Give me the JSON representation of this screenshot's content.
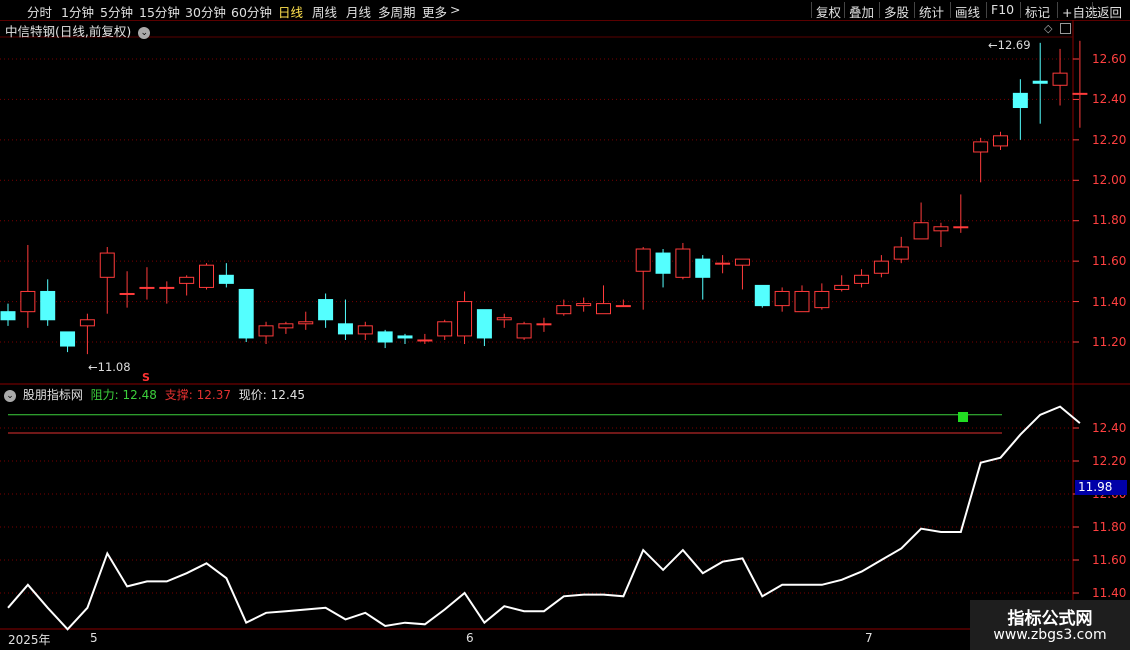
{
  "toolbar": {
    "periods": [
      "分时",
      "1分钟",
      "5分钟",
      "15分钟",
      "30分钟",
      "60分钟",
      "日线",
      "周线",
      "月线",
      "多周期",
      "更多"
    ],
    "active": "日线",
    "more_arrow": ">",
    "actions": [
      "复权",
      "叠加",
      "多股",
      "统计",
      "画线",
      "F10",
      "标记",
      "+自选",
      "返回"
    ]
  },
  "main_panel": {
    "title": "中信特钢(日线,前复权)",
    "dropdown_icon": "chevron-down-icon",
    "diamond_icon": "diamond-icon",
    "square_icon": "panel-toggle-icon",
    "price_labels": [
      "12.60",
      "12.40",
      "12.20",
      "12.00",
      "11.80",
      "11.60",
      "11.40",
      "11.20"
    ],
    "high_marker": "12.69",
    "low_marker": "11.08",
    "s_marker": "S"
  },
  "indicator_panel": {
    "name": "股朋指标网",
    "resistance_label": "阻力:",
    "resistance_value": "12.48",
    "support_label": "支撑:",
    "support_value": "12.37",
    "price_label": "现价:",
    "price_value": "12.45",
    "price_labels": [
      "12.40",
      "12.20",
      "12.00",
      "11.80",
      "11.60",
      "11.40"
    ],
    "current_tag": "11.98",
    "dropdown_icon": "chevron-down-icon"
  },
  "date_axis": {
    "year": "2025年",
    "months": [
      "5",
      "6",
      "7"
    ]
  },
  "watermark": {
    "title": "指标公式网",
    "url": "www.zbgs3.com"
  },
  "colors": {
    "up": "#ff3b3b",
    "down": "#54ffff",
    "grid": "#7a0000",
    "resistance": "#3ccf3c",
    "support": "#e03030",
    "line": "#ffffff",
    "active_period": "#ffe14d",
    "current_tag_bg": "#0000a8"
  },
  "chart_data": {
    "type": "candlestick",
    "x": [
      0,
      1,
      2,
      3,
      4,
      5,
      6,
      7,
      8,
      9,
      10,
      11,
      12,
      13,
      14,
      15,
      16,
      17,
      18,
      19,
      20,
      21,
      22,
      23,
      24,
      25,
      26,
      27,
      28,
      29,
      30,
      31,
      32,
      33,
      34,
      35,
      36,
      37,
      38,
      39,
      40,
      41,
      42,
      43,
      44,
      45,
      46,
      47,
      48,
      49,
      50
    ],
    "open": [
      11.35,
      11.35,
      11.45,
      11.25,
      11.28,
      11.52,
      11.44,
      11.47,
      11.47,
      11.49,
      11.47,
      11.53,
      11.46,
      11.23,
      11.27,
      11.29,
      11.41,
      11.29,
      11.24,
      11.25,
      11.23,
      11.21,
      11.23,
      11.23,
      11.36,
      11.31,
      11.22,
      11.29,
      11.34,
      11.38,
      11.34,
      11.38,
      11.55,
      11.64,
      11.52,
      11.61,
      11.59,
      11.58,
      11.48,
      11.38,
      11.35,
      11.37,
      11.46,
      11.49,
      11.54,
      11.61,
      11.71,
      11.75,
      11.77,
      12.14,
      12.17,
      12.43,
      12.49,
      12.47,
      12.43
    ],
    "close": [
      11.31,
      11.45,
      11.31,
      11.18,
      11.31,
      11.64,
      11.44,
      11.47,
      11.47,
      11.52,
      11.58,
      11.49,
      11.22,
      11.28,
      11.29,
      11.3,
      11.31,
      11.24,
      11.28,
      11.2,
      11.22,
      11.21,
      11.3,
      11.4,
      11.22,
      11.32,
      11.29,
      11.29,
      11.38,
      11.39,
      11.39,
      11.38,
      11.66,
      11.54,
      11.66,
      11.52,
      11.59,
      11.61,
      11.38,
      11.45,
      11.45,
      11.45,
      11.48,
      11.53,
      11.6,
      11.67,
      11.79,
      11.77,
      11.77,
      12.19,
      12.22,
      12.36,
      12.48,
      12.53,
      12.43
    ],
    "high": [
      11.39,
      11.68,
      11.51,
      11.21,
      11.34,
      11.67,
      11.55,
      11.57,
      11.5,
      11.53,
      11.59,
      11.59,
      11.46,
      11.3,
      11.3,
      11.35,
      11.44,
      11.41,
      11.3,
      11.26,
      11.24,
      11.24,
      11.31,
      11.45,
      11.36,
      11.34,
      11.3,
      11.32,
      11.41,
      11.42,
      11.48,
      11.41,
      11.67,
      11.66,
      11.69,
      11.63,
      11.63,
      11.61,
      11.48,
      11.47,
      11.48,
      11.49,
      11.53,
      11.56,
      11.63,
      11.72,
      11.89,
      11.79,
      11.93,
      12.21,
      12.24,
      12.5,
      12.68,
      12.65,
      12.69
    ],
    "low": [
      11.28,
      11.27,
      11.28,
      11.15,
      11.14,
      11.34,
      11.37,
      11.41,
      11.39,
      11.43,
      11.46,
      11.47,
      11.2,
      11.19,
      11.24,
      11.26,
      11.27,
      11.21,
      11.21,
      11.17,
      11.19,
      11.19,
      11.21,
      11.19,
      11.18,
      11.27,
      11.21,
      11.25,
      11.33,
      11.35,
      11.35,
      11.38,
      11.36,
      11.47,
      11.51,
      11.41,
      11.54,
      11.46,
      11.37,
      11.35,
      11.35,
      11.36,
      11.45,
      11.47,
      11.52,
      11.59,
      11.75,
      11.67,
      11.74,
      11.99,
      12.15,
      12.2,
      12.28,
      12.37,
      12.26
    ],
    "close_line": [
      11.31,
      11.45,
      11.31,
      11.18,
      11.31,
      11.64,
      11.44,
      11.47,
      11.47,
      11.52,
      11.58,
      11.49,
      11.22,
      11.28,
      11.29,
      11.3,
      11.31,
      11.24,
      11.28,
      11.2,
      11.22,
      11.21,
      11.3,
      11.4,
      11.22,
      11.32,
      11.29,
      11.29,
      11.38,
      11.39,
      11.39,
      11.38,
      11.66,
      11.54,
      11.66,
      11.52,
      11.59,
      11.61,
      11.38,
      11.45,
      11.45,
      11.45,
      11.48,
      11.53,
      11.6,
      11.67,
      11.79,
      11.77,
      11.77,
      12.19,
      12.22,
      12.36,
      12.48,
      12.53,
      12.43
    ],
    "resistance": 12.48,
    "support": 12.37,
    "current": 12.45,
    "main_ylim": [
      11.06,
      12.77
    ],
    "indicator_ylim": [
      11.25,
      12.61
    ]
  }
}
